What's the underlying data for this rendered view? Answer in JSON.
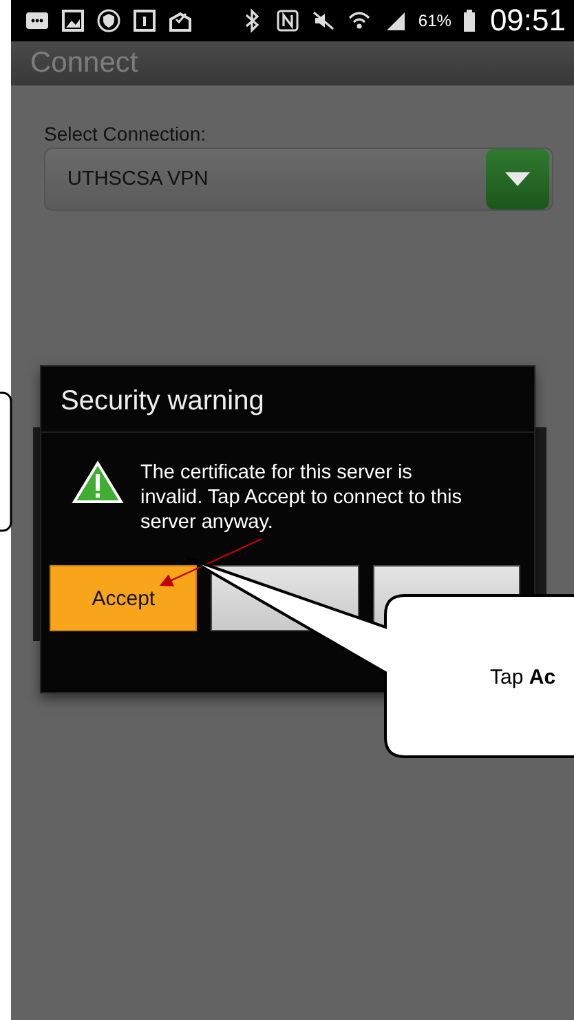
{
  "status_bar": {
    "battery": "61%",
    "time": "09:51"
  },
  "app_bar": {
    "title": "Connect"
  },
  "connection": {
    "label": "Select Connection:",
    "value": "UTHSCSA VPN"
  },
  "dialog": {
    "title": "Security warning",
    "message": "The certificate for this server is invalid. Tap Accept to connect to this server anyway.",
    "buttons": [
      {
        "label": "Accept",
        "kind": "primary"
      },
      {
        "kind": "plain"
      },
      {
        "kind": "plain"
      }
    ]
  },
  "callout": {
    "text": "Tap **Ac**"
  }
}
